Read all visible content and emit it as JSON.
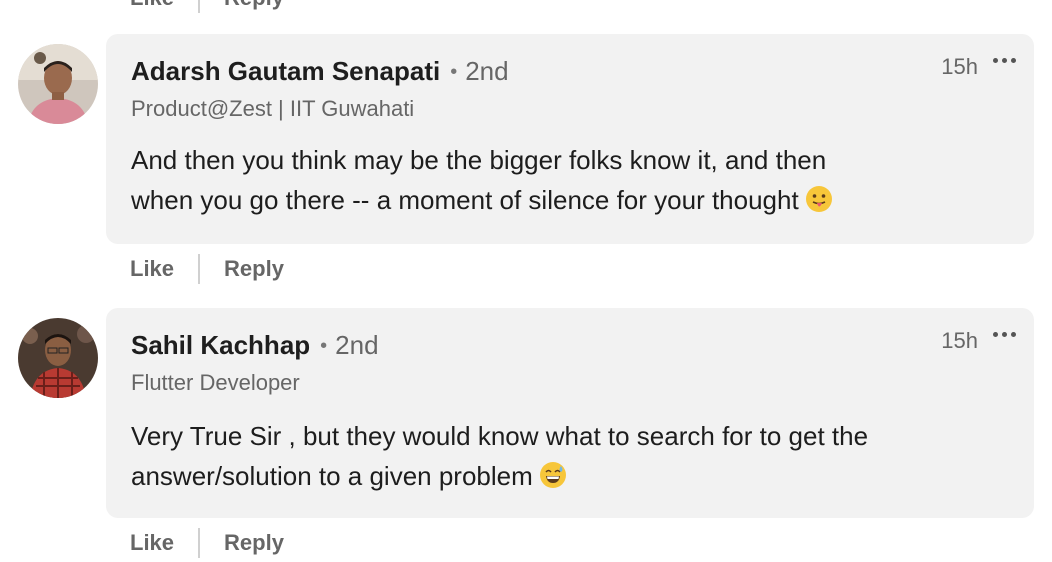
{
  "top_actions": {
    "like": "Like",
    "reply": "Reply"
  },
  "comments": [
    {
      "name": "Adarsh Gautam Senapati",
      "separator": "•",
      "degree": "2nd",
      "headline": "Product@Zest | IIT Guwahati",
      "time": "15h",
      "text_line1": "And then you think may be the bigger folks know it, and then",
      "text_line2": "when you go there -- a moment of silence for your thought",
      "emoji": "tongue-out-emoji",
      "like": "Like",
      "reply": "Reply"
    },
    {
      "name": "Sahil Kachhap",
      "separator": "•",
      "degree": "2nd",
      "headline": "Flutter Developer",
      "time": "15h",
      "text_line1": "Very True Sir , but they would know what to search for to get the",
      "text_line2": "answer/solution to a given problem",
      "emoji": "grinning-sweat-emoji",
      "like": "Like",
      "reply": "Reply"
    }
  ],
  "colors": {
    "bubble": "#f2f2f2",
    "secondary_text": "#666666",
    "primary_text": "#1d1d1d"
  }
}
